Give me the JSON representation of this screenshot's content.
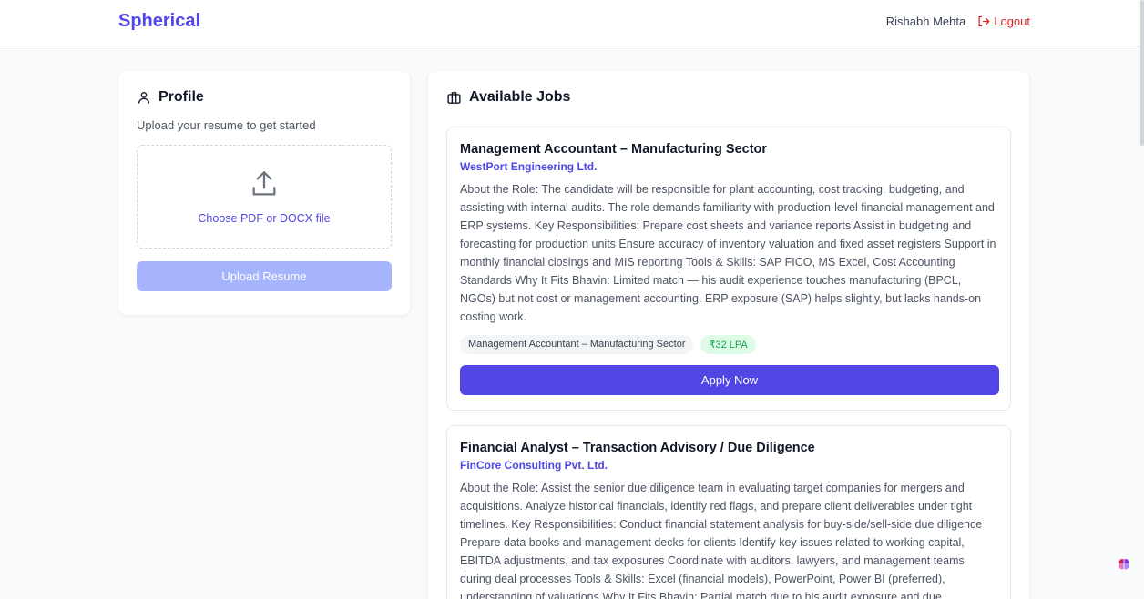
{
  "header": {
    "brand": "Spherical",
    "user_name": "Rishabh Mehta",
    "logout_label": "Logout"
  },
  "profile": {
    "title": "Profile",
    "subtitle": "Upload your resume to get started",
    "dropzone_label": "Choose PDF or DOCX file",
    "upload_button": "Upload Resume"
  },
  "jobs": {
    "title": "Available Jobs",
    "items": [
      {
        "title": "Management Accountant – Manufacturing Sector",
        "company": "WestPort Engineering Ltd.",
        "description": "About the Role: The candidate will be responsible for plant accounting, cost tracking, budgeting, and assisting with internal audits. The role demands familiarity with production-level financial management and ERP systems. Key Responsibilities: Prepare cost sheets and variance reports Assist in budgeting and forecasting for production units Ensure accuracy of inventory valuation and fixed asset registers Support in monthly financial closings and MIS reporting Tools & Skills: SAP FICO, MS Excel, Cost Accounting Standards Why It Fits Bhavin: Limited match — his audit experience touches manufacturing (BPCL, NGOs) but not cost or management accounting. ERP exposure (SAP) helps slightly, but lacks hands-on costing work.",
        "tag_role": "Management Accountant – Manufacturing Sector",
        "tag_pay": "₹32 LPA",
        "apply_label": "Apply Now"
      },
      {
        "title": "Financial Analyst – Transaction Advisory / Due Diligence",
        "company": "FinCore Consulting Pvt. Ltd.",
        "description": "About the Role: Assist the senior due diligence team in evaluating target companies for mergers and acquisitions. Analyze historical financials, identify red flags, and prepare client deliverables under tight timelines. Key Responsibilities: Conduct financial statement analysis for buy-side/sell-side due diligence Prepare data books and management decks for clients Identify key issues related to working capital, EBITDA adjustments, and tax exposures Coordinate with auditors, lawyers, and management teams during deal processes Tools & Skills: Excel (financial models), PowerPoint, Power BI (preferred), understanding of valuations Why It Fits Bhavin: Partial match due to his audit exposure and due"
      }
    ]
  },
  "colors": {
    "accent": "#4f46e5",
    "accent_disabled": "#a5b4fc",
    "logout": "#dc2626",
    "pay_tag_bg": "#dcfce7",
    "pay_tag_text": "#16a34a"
  },
  "icons": {
    "profile": "user-icon",
    "jobs": "briefcase-icon",
    "upload": "upload-icon",
    "logout": "logout-icon",
    "assistant": "brain-icon"
  }
}
